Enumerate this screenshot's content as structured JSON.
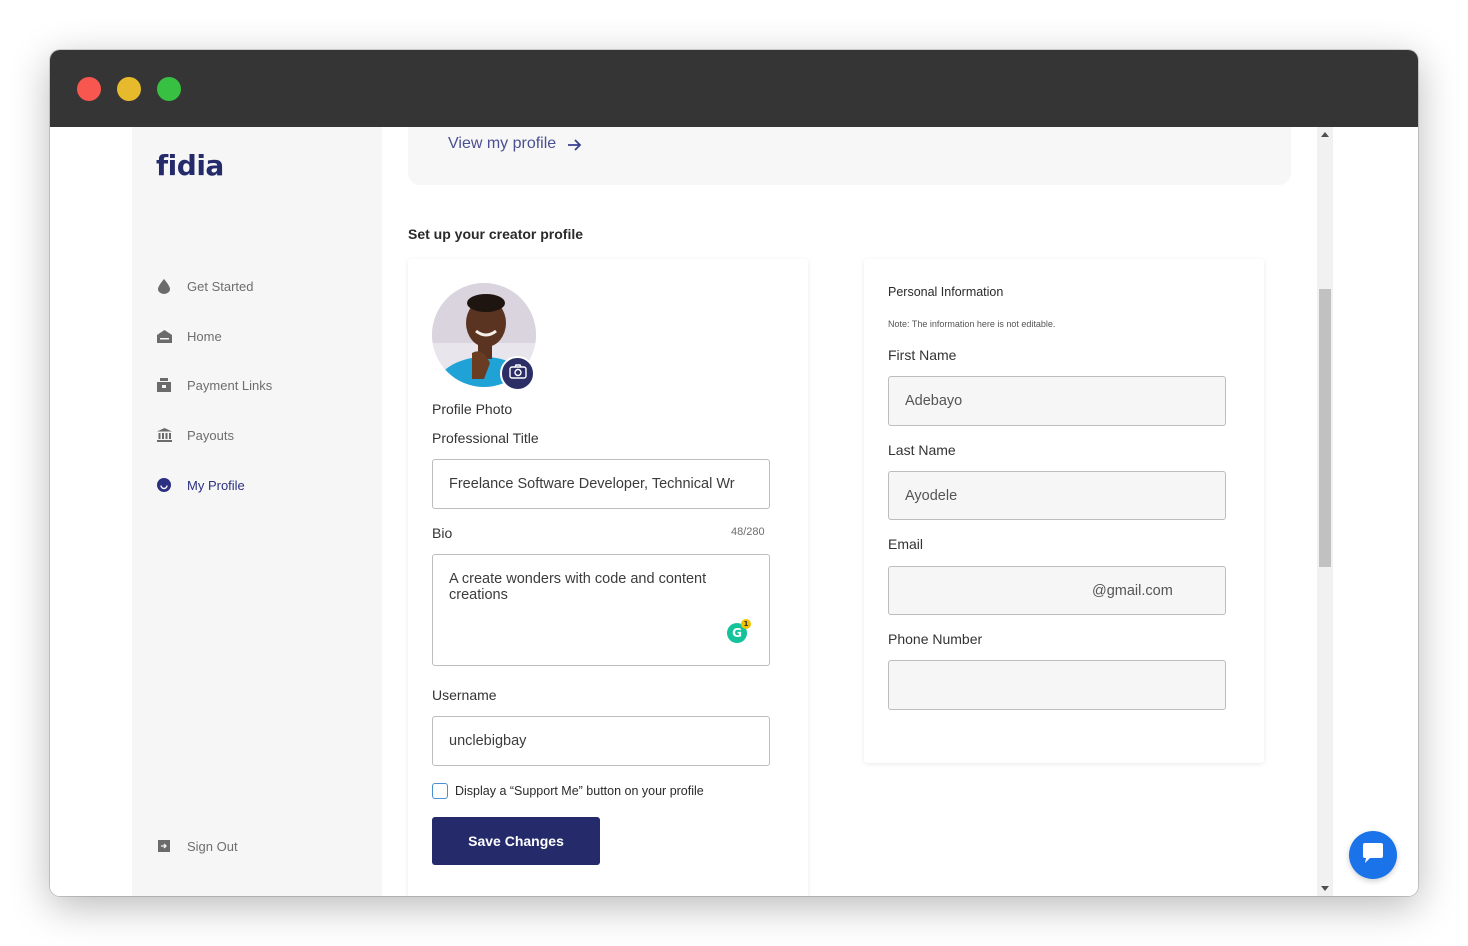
{
  "app": {
    "logo": "fidia"
  },
  "sidebar": {
    "items": [
      {
        "label": "Get Started",
        "icon": "drop-icon"
      },
      {
        "label": "Home",
        "icon": "home-icon"
      },
      {
        "label": "Payment Links",
        "icon": "wallet-icon"
      },
      {
        "label": "Payouts",
        "icon": "bank-icon"
      },
      {
        "label": "My Profile",
        "icon": "profile-icon",
        "active": true
      }
    ],
    "sign_out": "Sign Out"
  },
  "banner": {
    "view_profile": "View my profile"
  },
  "creator_profile": {
    "section_title": "Set up your creator profile",
    "photo_label": "Profile Photo",
    "title_label": "Professional Title",
    "title_value": "Freelance Software Developer, Technical Wr",
    "bio_label": "Bio",
    "bio_counter": "48/280",
    "bio_value": "A create wonders with code and content creations",
    "username_label": "Username",
    "username_value": "unclebigbay",
    "support_checkbox_label": "Display a “Support Me” button on your profile",
    "support_checked": false,
    "save_label": "Save Changes"
  },
  "personal_info": {
    "title": "Personal Information",
    "note": "Note: The information here is not editable.",
    "first_name_label": "First Name",
    "first_name_value": "Adebayo",
    "last_name_label": "Last Name",
    "last_name_value": "Ayodele",
    "email_label": "Email",
    "email_value": "@gmail.com",
    "phone_label": "Phone Number",
    "phone_value": ""
  },
  "colors": {
    "brand": "#252a6b",
    "titlebar": "#353535",
    "sidebar_bg": "#f6f6f6",
    "chat_button": "#1a73e8",
    "traffic_red": "#f8574f",
    "traffic_yellow": "#e7b92d",
    "traffic_green": "#38c043"
  }
}
